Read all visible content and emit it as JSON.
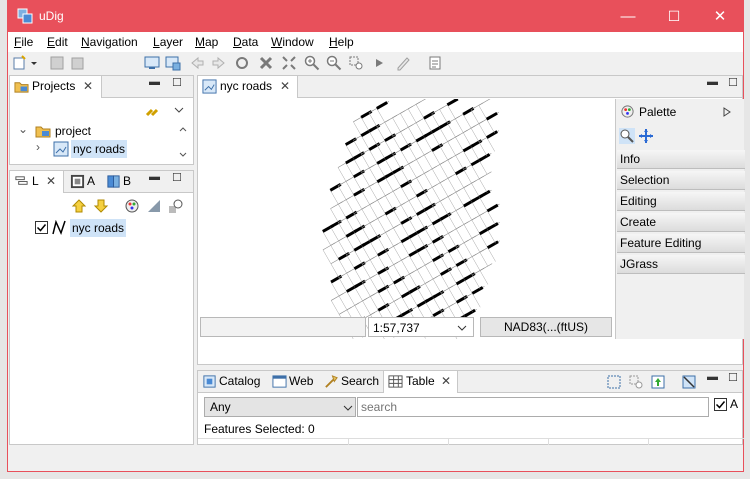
{
  "window": {
    "title": "uDig",
    "minimize": "—",
    "maximize": "☐",
    "close": "✕"
  },
  "menu": [
    {
      "label": "File",
      "key": "F",
      "rest": "ile"
    },
    {
      "label": "Edit",
      "key": "E",
      "rest": "dit"
    },
    {
      "label": "Navigation",
      "key": "N",
      "rest": "avigation"
    },
    {
      "label": "Layer",
      "key": "L",
      "rest": "ayer"
    },
    {
      "label": "Map",
      "key": "M",
      "rest": "ap"
    },
    {
      "label": "Data",
      "key": "D",
      "rest": "ata"
    },
    {
      "label": "Window",
      "key": "W",
      "rest": "indow"
    },
    {
      "label": "Help",
      "key": "H",
      "rest": "elp"
    }
  ],
  "projects": {
    "tab_label": "Projects",
    "project_label": "project",
    "map_label": "nyc roads"
  },
  "layers": {
    "tab_l": "L",
    "tab_a": "A",
    "tab_b": "B",
    "layer_label": "nyc roads"
  },
  "map_editor": {
    "tab_label": "nyc roads",
    "scale": "1:57,737",
    "crs": "NAD83(...(ftUS)"
  },
  "palette": {
    "title": "Palette",
    "items": [
      "Info",
      "Selection",
      "Editing",
      "Create",
      "Feature Editing",
      "JGrass"
    ]
  },
  "bottom": {
    "tabs": [
      "Catalog",
      "Web",
      "Search",
      "Table"
    ],
    "filter_value": "Any",
    "search_placeholder": "search",
    "checkbox_label": "A",
    "features_selected": "Features Selected: 0"
  },
  "colors": {
    "titlebar": "#e8505b",
    "selection": "#cfe3f7"
  }
}
